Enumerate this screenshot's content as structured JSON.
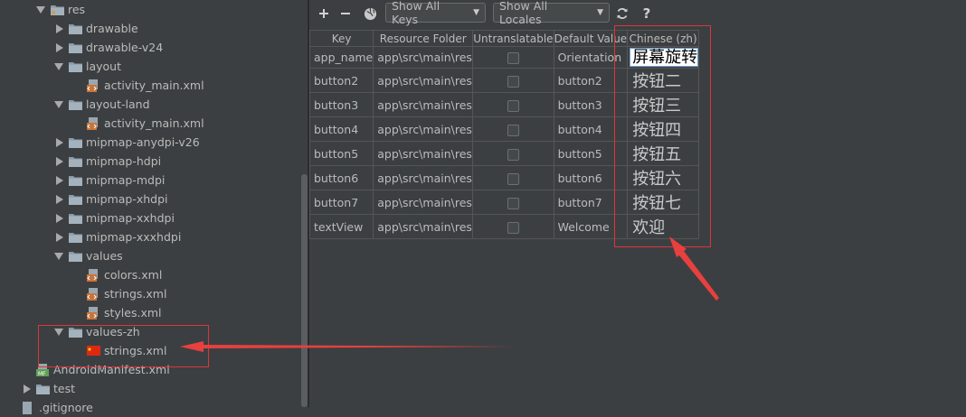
{
  "tree": {
    "items": [
      {
        "label": "res",
        "level": 0,
        "expanded": true,
        "kind": "folder"
      },
      {
        "label": "drawable",
        "level": 1,
        "expanded": false,
        "kind": "folder"
      },
      {
        "label": "drawable-v24",
        "level": 1,
        "expanded": false,
        "kind": "folder"
      },
      {
        "label": "layout",
        "level": 1,
        "expanded": true,
        "kind": "folder"
      },
      {
        "label": "activity_main.xml",
        "level": 2,
        "kind": "xml-layout"
      },
      {
        "label": "layout-land",
        "level": 1,
        "expanded": true,
        "kind": "folder"
      },
      {
        "label": "activity_main.xml",
        "level": 2,
        "kind": "xml-layout"
      },
      {
        "label": "mipmap-anydpi-v26",
        "level": 1,
        "expanded": false,
        "kind": "folder"
      },
      {
        "label": "mipmap-hdpi",
        "level": 1,
        "expanded": false,
        "kind": "folder"
      },
      {
        "label": "mipmap-mdpi",
        "level": 1,
        "expanded": false,
        "kind": "folder"
      },
      {
        "label": "mipmap-xhdpi",
        "level": 1,
        "expanded": false,
        "kind": "folder"
      },
      {
        "label": "mipmap-xxhdpi",
        "level": 1,
        "expanded": false,
        "kind": "folder"
      },
      {
        "label": "mipmap-xxxhdpi",
        "level": 1,
        "expanded": false,
        "kind": "folder"
      },
      {
        "label": "values",
        "level": 1,
        "expanded": true,
        "kind": "folder"
      },
      {
        "label": "colors.xml",
        "level": 2,
        "kind": "xml-values"
      },
      {
        "label": "strings.xml",
        "level": 2,
        "kind": "xml-values"
      },
      {
        "label": "styles.xml",
        "level": 2,
        "kind": "xml-values"
      },
      {
        "label": "values-zh",
        "level": 1,
        "expanded": true,
        "kind": "folder"
      },
      {
        "label": "strings.xml",
        "level": 2,
        "kind": "flag-cn"
      },
      {
        "label": "AndroidManifest.xml",
        "level": 0,
        "kind": "manifest"
      },
      {
        "label": "test",
        "level": -1,
        "expanded": false,
        "kind": "folder"
      },
      {
        "label": ".gitignore",
        "level": -1,
        "kind": "file"
      }
    ]
  },
  "toolbar": {
    "add_icon": "plus-icon",
    "remove_icon": "minus-icon",
    "globe_icon": "globe-icon",
    "show_keys": "Show All Keys",
    "show_locales": "Show All Locales",
    "refresh_icon": "refresh-icon",
    "help": "?"
  },
  "table": {
    "columns": [
      "Key",
      "Resource Folder",
      "Untranslatable",
      "Default Value",
      "Chinese (zh)"
    ],
    "rows": [
      {
        "key": "app_name",
        "folder": "app\\src\\main\\res",
        "untranslatable": false,
        "default": "Orientation",
        "zh": "屏幕旋转"
      },
      {
        "key": "button2",
        "folder": "app\\src\\main\\res",
        "untranslatable": false,
        "default": "button2",
        "zh": "按钮二"
      },
      {
        "key": "button3",
        "folder": "app\\src\\main\\res",
        "untranslatable": false,
        "default": "button3",
        "zh": "按钮三"
      },
      {
        "key": "button4",
        "folder": "app\\src\\main\\res",
        "untranslatable": false,
        "default": "button4",
        "zh": "按钮四"
      },
      {
        "key": "button5",
        "folder": "app\\src\\main\\res",
        "untranslatable": false,
        "default": "button5",
        "zh": "按钮五"
      },
      {
        "key": "button6",
        "folder": "app\\src\\main\\res",
        "untranslatable": false,
        "default": "button6",
        "zh": "按钮六"
      },
      {
        "key": "button7",
        "folder": "app\\src\\main\\res",
        "untranslatable": false,
        "default": "button7",
        "zh": "按钮七"
      },
      {
        "key": "textView",
        "folder": "app\\src\\main\\res",
        "untranslatable": false,
        "default": "Welcome",
        "zh": "欢迎"
      }
    ]
  },
  "colors": {
    "panel": "#3c3f41",
    "text": "#bbbbbb",
    "annotation_red": "#d9363e",
    "folder": "#8a9ba8"
  }
}
